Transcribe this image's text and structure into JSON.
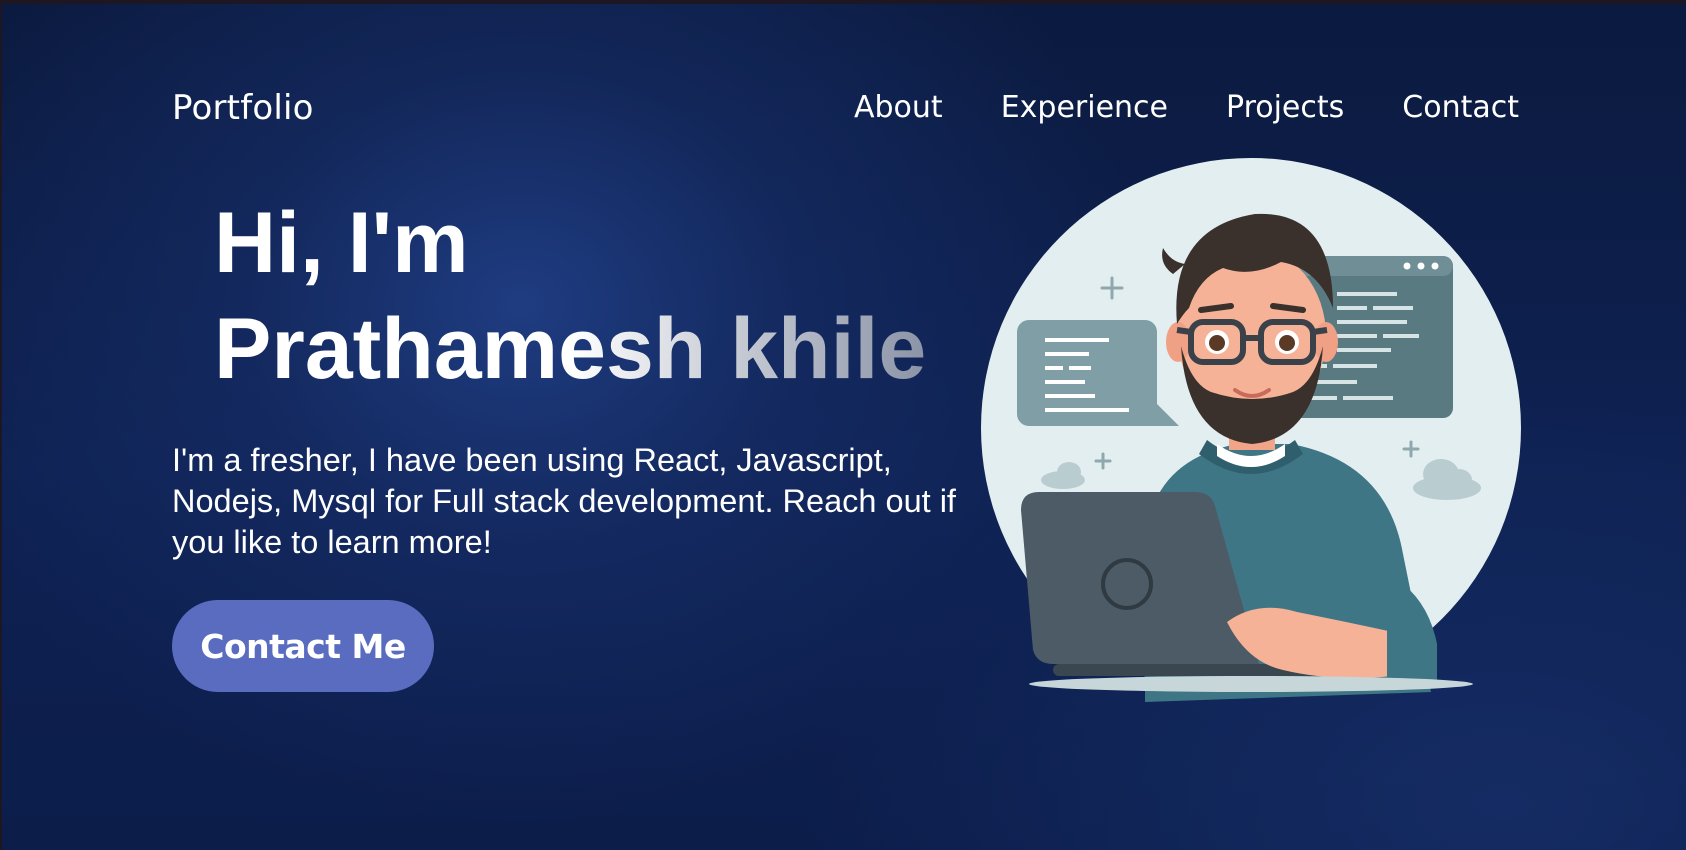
{
  "header": {
    "logo": "Portfolio",
    "nav": [
      {
        "label": "About"
      },
      {
        "label": "Experience"
      },
      {
        "label": "Projects"
      },
      {
        "label": "Contact"
      }
    ]
  },
  "hero": {
    "greeting": "Hi, I'm",
    "name": "Prathamesh khile",
    "description": "I'm a fresher, I have been using React, Javascript, Nodejs, Mysql for Full stack development. Reach out if you like to learn more!",
    "cta_label": "Contact Me",
    "illustration_icon": "developer-avatar-icon"
  },
  "colors": {
    "background": "#0e2152",
    "accent": "#5a6cc0",
    "text": "#ffffff"
  }
}
